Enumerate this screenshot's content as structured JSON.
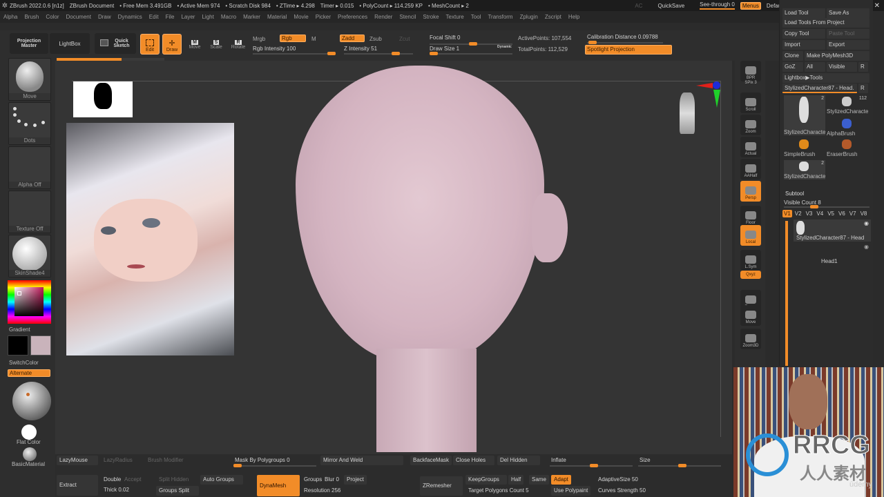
{
  "titlebar": {
    "app": "ZBrush 2022.0.6 [n1z]",
    "doc": "ZBrush Document",
    "free_mem": "• Free Mem 3.491GB",
    "active_mem": "• Active Mem 974",
    "scratch": "• Scratch Disk 984",
    "ztime": "• ZTime ▸ 4.298",
    "timer": "Timer ▸ 0.015",
    "polycount": "• PolyCount ▸ 114.259 KP",
    "meshcount": "• MeshCount ▸ 2",
    "ac": "AC",
    "quicksave": "QuickSave",
    "seethrough": "See-through 0",
    "menus": "Menus",
    "defaultzscript": "DefaultZScript"
  },
  "menubar": [
    "Alpha",
    "Brush",
    "Color",
    "Document",
    "Draw",
    "Dynamics",
    "Edit",
    "File",
    "Layer",
    "Light",
    "Macro",
    "Marker",
    "Material",
    "Movie",
    "Picker",
    "Preferences",
    "Render",
    "Stencil",
    "Stroke",
    "Texture",
    "Tool",
    "Transform",
    "Zplugin",
    "Zscript",
    "Help"
  ],
  "toolbar": {
    "projection_master": "Projection Master",
    "lightbox": "LightBox",
    "quick_sketch": "Quick Sketch",
    "edit": "Edit",
    "draw": "Draw",
    "move": "Move",
    "scale": "Scale",
    "rotate": "Rotate",
    "mrgb": "Mrgb",
    "rgb": "Rgb",
    "m": "M",
    "rgb_intensity": "Rgb Intensity 100",
    "zadd": "Zadd",
    "zsub": "Zsub",
    "zcut": "Zcut",
    "z_intensity": "Z Intensity 51",
    "focal_shift": "Focal Shift 0",
    "draw_size": "Draw Size 1",
    "dynamic": "Dynamic",
    "active_points": "ActivePoints: 107,554",
    "total_points": "TotalPoints: 112,529",
    "calibration": "Calibration Distance 0.09788",
    "spotlight": "Spotlight Projection",
    "progress": 0.6
  },
  "leftshelf": {
    "brush": "Move",
    "stroke": "Dots",
    "alpha": "Alpha Off",
    "texture": "Texture Off",
    "material": "SkinShade4",
    "gradient": "Gradient",
    "switchcolor": "SwitchColor",
    "alternate": "Alternate",
    "flat_color": "Flat Color",
    "basic_material": "BasicMaterial",
    "main_color": "#000000",
    "secondary_color": "#c9b3bb"
  },
  "rightshelf": [
    "BPR",
    "SPix 3",
    "Scroll",
    "Zoom",
    "Actual",
    "AAHalf",
    "Persp",
    "Floor",
    "Local",
    "L.Sym",
    "Qxyz",
    "Frame",
    "Move",
    "Zoom3D"
  ],
  "rpanel": {
    "load_tool": "Load Tool",
    "save_as": "Save As",
    "load_from_project": "Load Tools From Project",
    "copy_tool": "Copy Tool",
    "paste_tool": "Paste Tool",
    "import": "Import",
    "export": "Export",
    "clone": "Clone",
    "make_polymesh": "Make PolyMesh3D",
    "goz": "GoZ",
    "all": "All",
    "visible": "Visible",
    "r": "R",
    "lightbox_tools": "Lightbox▶Tools",
    "current_tool": "StylizedCharacter87 - Head.",
    "tools": [
      {
        "label": "StylizedCharacte",
        "count": "2"
      },
      {
        "label": "StylizedCharacte",
        "count": "112"
      },
      {
        "label": "SimpleBrush",
        "count": ""
      },
      {
        "label": "AlphaBrush",
        "count": ""
      },
      {
        "label": "EraserBrush",
        "count": ""
      },
      {
        "label": "StylizedCharacte",
        "count": "2"
      }
    ],
    "subtool": "Subtool",
    "visible_count": "Visible Count 8",
    "versions": [
      "V1",
      "V2",
      "V3",
      "V4",
      "V5",
      "V6",
      "V7",
      "V8"
    ],
    "subtools": [
      "StylizedCharacter87 - Head",
      "Head1"
    ]
  },
  "bottom": {
    "lazymouse": "LazyMouse",
    "lazyradius": "LazyRadius",
    "brush_modifier": "Brush Modifier",
    "mask_by_polygroups": "Mask By Polygroups 0",
    "mirror_and_weld": "Mirror And Weld",
    "backface_mask": "BackfaceMask",
    "close_holes": "Close Holes",
    "del_hidden": "Del Hidden",
    "inflate": "Inflate",
    "size": "Size",
    "extract": "Extract",
    "double": "Double",
    "accept": "Accept",
    "thick": "Thick 0.02",
    "split_hidden": "Split Hidden",
    "groups_split": "Groups Split",
    "auto_groups": "Auto Groups",
    "dynamesh": "DynaMesh",
    "groups": "Groups",
    "blur": "Blur 0",
    "project": "Project",
    "resolution": "Resolution 256",
    "zremesher": "ZRemesher",
    "keepgroups": "KeepGroups",
    "half": "Half",
    "same": "Same",
    "adapt": "Adapt",
    "target_polygons": "Target Polygons Count 5",
    "use_polypaint": "Use Polypaint",
    "adaptive_size": "AdaptiveSize 50",
    "curves_strength": "Curves Strength 50"
  },
  "watermark": {
    "brand": "RRCG",
    "sub": "人人素材",
    "udemy": "ūdemy"
  }
}
